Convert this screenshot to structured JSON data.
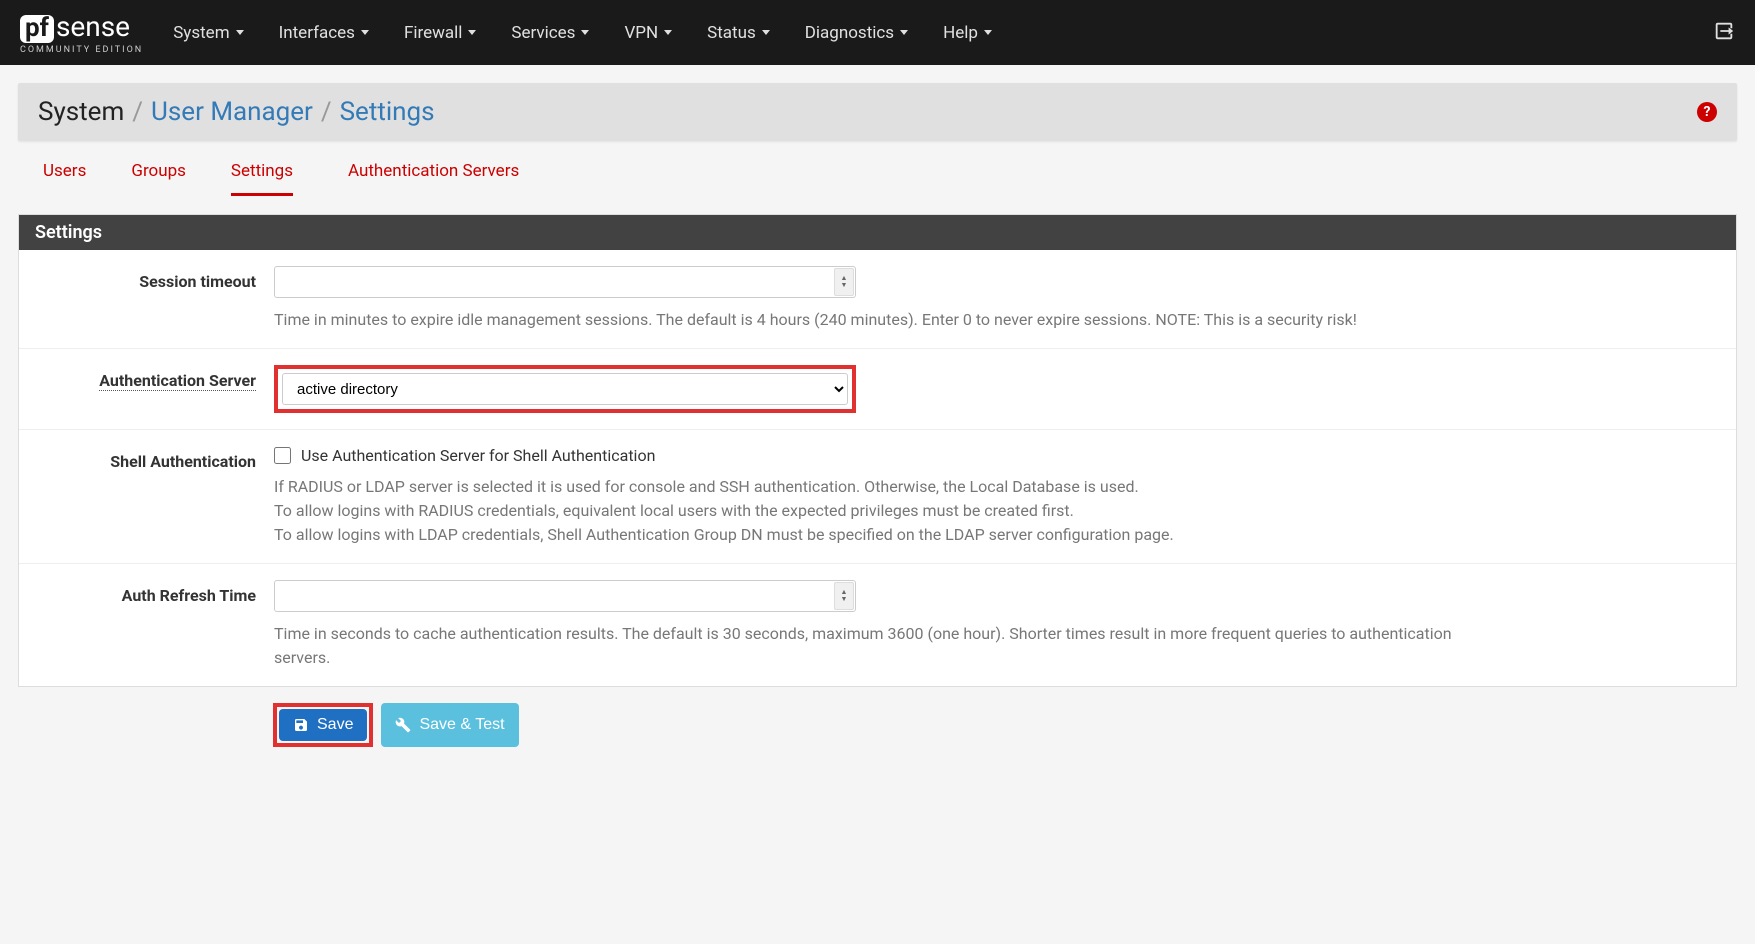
{
  "logo": {
    "main": "sense",
    "box": "pf",
    "sub": "COMMUNITY EDITION"
  },
  "nav": {
    "items": [
      "System",
      "Interfaces",
      "Firewall",
      "Services",
      "VPN",
      "Status",
      "Diagnostics",
      "Help"
    ]
  },
  "breadcrumb": {
    "root": "System",
    "path1": "User Manager",
    "path2": "Settings"
  },
  "tabs": {
    "items": [
      "Users",
      "Groups",
      "Settings",
      "Authentication Servers"
    ],
    "active_index": 2
  },
  "panel": {
    "title": "Settings",
    "fields": {
      "session_timeout": {
        "label": "Session timeout",
        "value": "",
        "help": "Time in minutes to expire idle management sessions. The default is 4 hours (240 minutes). Enter 0 to never expire sessions. NOTE: This is a security risk!"
      },
      "auth_server": {
        "label": "Authentication Server",
        "value": "active directory"
      },
      "shell_auth": {
        "label": "Shell Authentication",
        "checkbox_label": "Use Authentication Server for Shell Authentication",
        "checked": false,
        "help_line1": "If RADIUS or LDAP server is selected it is used for console and SSH authentication. Otherwise, the Local Database is used.",
        "help_line2": "To allow logins with RADIUS credentials, equivalent local users with the expected privileges must be created first.",
        "help_line3": "To allow logins with LDAP credentials, Shell Authentication Group DN must be specified on the LDAP server configuration page."
      },
      "auth_refresh": {
        "label": "Auth Refresh Time",
        "value": "",
        "help": "Time in seconds to cache authentication results. The default is 30 seconds, maximum 3600 (one hour). Shorter times result in more frequent queries to authentication servers."
      }
    },
    "buttons": {
      "save": "Save",
      "save_test": "Save & Test"
    }
  }
}
